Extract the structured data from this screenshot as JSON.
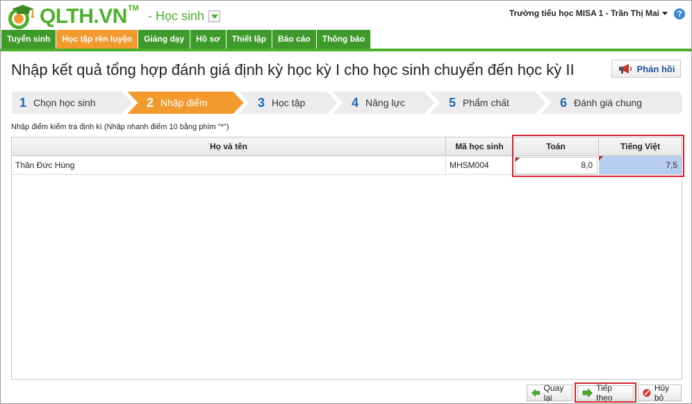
{
  "header": {
    "logo_text": "QLTH.VN",
    "logo_tm": "TM",
    "module": "- Học sinh",
    "user": "Trường tiểu học MISA 1 - Trần Thị Mai",
    "help": "?"
  },
  "menu": {
    "items": [
      {
        "label": "Tuyển sinh"
      },
      {
        "label": "Học tập rèn luyện"
      },
      {
        "label": "Giảng dạy"
      },
      {
        "label": "Hồ sơ"
      },
      {
        "label": "Thiết lập"
      },
      {
        "label": "Báo cáo"
      },
      {
        "label": "Thông báo"
      }
    ],
    "active_index": 1
  },
  "page": {
    "title": "Nhập kết quả tổng hợp đánh giá định kỳ học kỳ I cho học sinh chuyển đến học kỳ II",
    "feedback_label": "Phản hồi",
    "hint": "Nhập điểm kiểm tra định kì (Nhập nhanh điểm 10 bằng phím \"*\")"
  },
  "wizard": {
    "steps": [
      {
        "num": "1",
        "label": "Chọn học sinh"
      },
      {
        "num": "2",
        "label": "Nhập điểm"
      },
      {
        "num": "3",
        "label": "Học tập"
      },
      {
        "num": "4",
        "label": "Năng lực"
      },
      {
        "num": "5",
        "label": "Phẩm chất"
      },
      {
        "num": "6",
        "label": "Đánh giá chung"
      }
    ],
    "active_index": 1
  },
  "grid": {
    "columns": [
      "Họ và tên",
      "Mã học sinh",
      "Toán",
      "Tiếng Việt"
    ],
    "rows": [
      {
        "name": "Thân Đức Hùng",
        "code": "MHSM004",
        "toan": "8,0",
        "tieng_viet": "7,5"
      }
    ]
  },
  "buttons": {
    "back": "Quay lại",
    "next": "Tiếp theo",
    "cancel": "Hủy bỏ"
  },
  "colors": {
    "brand_green": "#4caf2a",
    "menu_green": "#3e9a2a",
    "active_orange": "#f29a2e",
    "step_number_blue": "#1c6ab0",
    "highlight_red": "#d41f2a",
    "selected_cell_blue": "#b8cef0"
  }
}
